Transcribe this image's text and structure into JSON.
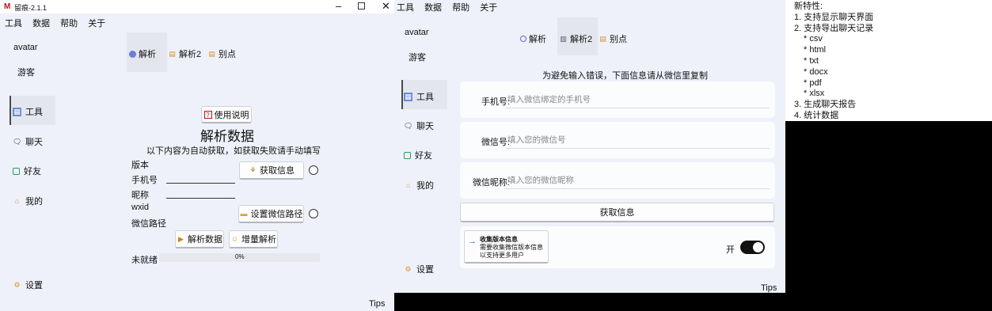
{
  "win1": {
    "title": "留痕-2.1.1",
    "menu": [
      "工具",
      "数据",
      "帮助",
      "关于"
    ],
    "avatar": "avatar",
    "guest": "游客",
    "nav": [
      "工具",
      "聊天",
      "好友",
      "我的"
    ],
    "settings": "设置",
    "tabs": [
      "解析",
      "解析2",
      "别点"
    ],
    "help_button": "使用说明",
    "heading": "解析数据",
    "subheading": "以下内容为自动获取，如获取失败请手动填写",
    "labels": [
      "版本",
      "手机号",
      "昵称",
      "wxid",
      "微信路径"
    ],
    "get_info_button": "获取信息",
    "set_path_button": "设置微信路径",
    "parse_button": "解析数据",
    "incremental_button": "增量解析",
    "status": "未就绪",
    "progress_text": "0%",
    "progress": 0,
    "tips": "Tips"
  },
  "win2": {
    "menu": [
      "工具",
      "数据",
      "帮助",
      "关于"
    ],
    "avatar": "avatar",
    "guest": "游客",
    "tabs": [
      "解析",
      "解析2",
      "别点"
    ],
    "nav": [
      "工具",
      "聊天",
      "好友",
      "我的"
    ],
    "settings": "设置",
    "notice": "为避免输入错误，下面信息请从微信里复制",
    "fields": [
      {
        "label": "手机号:",
        "placeholder": "填入微信绑定的手机号"
      },
      {
        "label": "微信号:",
        "placeholder": "填入您的微信号"
      },
      {
        "label": "微信昵称:",
        "placeholder": "填入您的微信昵称"
      }
    ],
    "get_info_button": "获取信息",
    "collect_title": "收集版本信息",
    "collect_desc": "需要收集微信版本信息以支持更多用户",
    "toggle_label": "开",
    "tips": "Tips"
  },
  "changelog": {
    "title": "新特性:",
    "lines": [
      "1. 支持显示聊天界面",
      "2. 支持导出聊天记录",
      "* csv",
      "* html",
      "* txt",
      "* docx",
      "* pdf",
      "* xlsx",
      "3. 生成聊天报告",
      "4. 统计数据"
    ]
  },
  "colors": {
    "window_bg": "#eef1f9",
    "panel_bg": "#f5f7fc",
    "toggle_bg": "#111111"
  }
}
